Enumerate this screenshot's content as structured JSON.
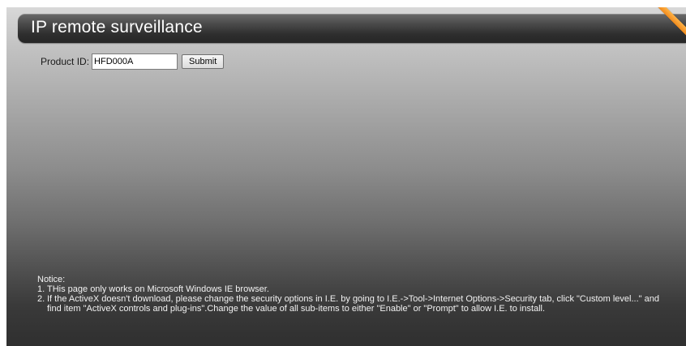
{
  "header": {
    "title": "IP remote surveillance"
  },
  "form": {
    "product_id_label": "Product ID:",
    "product_id_value": "HFD000A",
    "submit_label": "Submit"
  },
  "notice": {
    "heading": "Notice:",
    "items": [
      {
        "number": "1.",
        "text": "THis page only works on Microsoft Windows IE browser."
      },
      {
        "number": "2.",
        "text": "If the ActiveX doesn't download, please change the security options in I.E. by going to I.E.->Tool->Internet Options->Security tab, click \"Custom level...\" and find item \"ActiveX controls and plug-ins\".Change the value of all sub-items to either \"Enable\" or \"Prompt\" to allow I.E. to install."
      }
    ]
  },
  "colors": {
    "accent": "#f08a1c",
    "title_bar": "#2e2e2e",
    "title_text": "#ffffff",
    "notice_text": "#f2f2f2"
  },
  "icons": {
    "corner_decoration": "orange-corner-ribbon"
  }
}
